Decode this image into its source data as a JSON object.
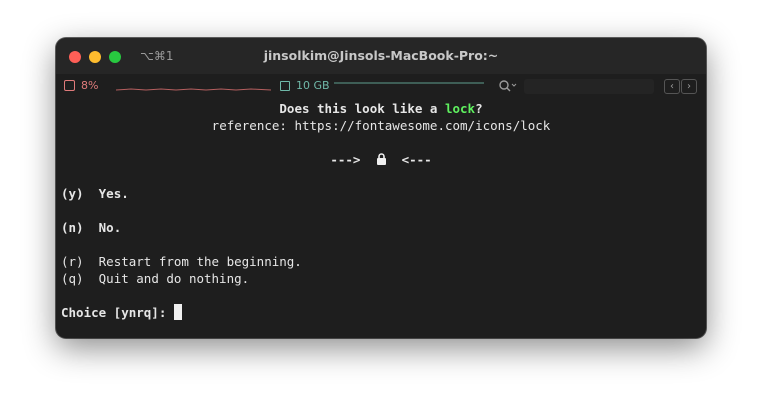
{
  "window": {
    "shortcut": "⌥⌘1",
    "title": "jinsolkim@Jinsols-MacBook-Pro:~"
  },
  "status": {
    "cpu": "8%",
    "memory": "10 GB",
    "cpu_color": "#e07b7b",
    "memory_color": "#6fb8a8"
  },
  "terminal": {
    "question_prefix": "Does this look like a ",
    "question_word": "lock",
    "question_suffix": "?",
    "reference": "reference: https://fontawesome.com/icons/lock",
    "arrow_left": "--->",
    "arrow_right": "<---",
    "icon": "lock-icon",
    "options": [
      {
        "key": "(y)",
        "label": "Yes."
      },
      {
        "key": "(n)",
        "label": "No."
      },
      {
        "key": "(r)",
        "label": "Restart from the beginning."
      },
      {
        "key": "(q)",
        "label": "Quit and do nothing."
      }
    ],
    "prompt": "Choice [ynrq]:"
  }
}
